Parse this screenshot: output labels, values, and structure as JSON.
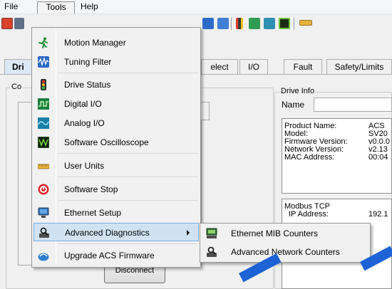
{
  "menubar": {
    "items": [
      "File",
      "Tools",
      "Help"
    ]
  },
  "tabs": [
    {
      "label": "Dri",
      "active": true
    },
    {
      "label": "elect",
      "active": false
    },
    {
      "label": "I/O",
      "active": false
    },
    {
      "label": "Fault",
      "active": false
    },
    {
      "label": "Safety/Limits",
      "active": false
    }
  ],
  "left_group": {
    "label": "Co"
  },
  "drive_info": {
    "label": "Drive Info",
    "name_label": "Name",
    "rows": [
      {
        "key": "Product Name:",
        "value": "ACS"
      },
      {
        "key": "Model:",
        "value": "SV20"
      },
      {
        "key": "Firmware Version:",
        "value": "v0.0.0"
      },
      {
        "key": "Network Version:",
        "value": "v2.13"
      },
      {
        "key": "MAC Address:",
        "value": "00:04"
      }
    ],
    "modbus_title": "Modbus TCP",
    "ip_key": "IP Address:",
    "ip_value": "192.1"
  },
  "disconnect_button": "Disconnect",
  "tools_menu": {
    "items": [
      {
        "label": "Motion Manager",
        "icon": "running-man-icon"
      },
      {
        "label": "Tuning Filter",
        "icon": "waveform-icon"
      },
      {
        "label": "Drive Status",
        "icon": "traffic-light-icon"
      },
      {
        "label": "Digital I/O",
        "icon": "digital-io-icon"
      },
      {
        "label": "Analog I/O",
        "icon": "analog-io-icon"
      },
      {
        "label": "Software Oscilloscope",
        "icon": "oscilloscope-icon"
      },
      {
        "label": "User Units",
        "icon": "ruler-icon"
      },
      {
        "label": "Software Stop",
        "icon": "stop-icon"
      },
      {
        "label": "Ethernet Setup",
        "icon": "monitor-icon"
      },
      {
        "label": "Advanced Diagnostics",
        "icon": "diagnostics-icon"
      },
      {
        "label": "Upgrade ACS Firmware",
        "icon": "upgrade-icon"
      }
    ]
  },
  "diagnostics_submenu": {
    "items": [
      {
        "label": "Ethernet MIB Counters",
        "icon": "mib-counter-icon"
      },
      {
        "label": "Advanced Network Counters",
        "icon": "network-diagnostics-icon"
      }
    ]
  },
  "colors": {
    "menu_highlight": "#d1e2f2",
    "menu_highlight_border": "#78aee5",
    "watermark": "#1e63d6",
    "tab_active": "#dbe8f5"
  }
}
